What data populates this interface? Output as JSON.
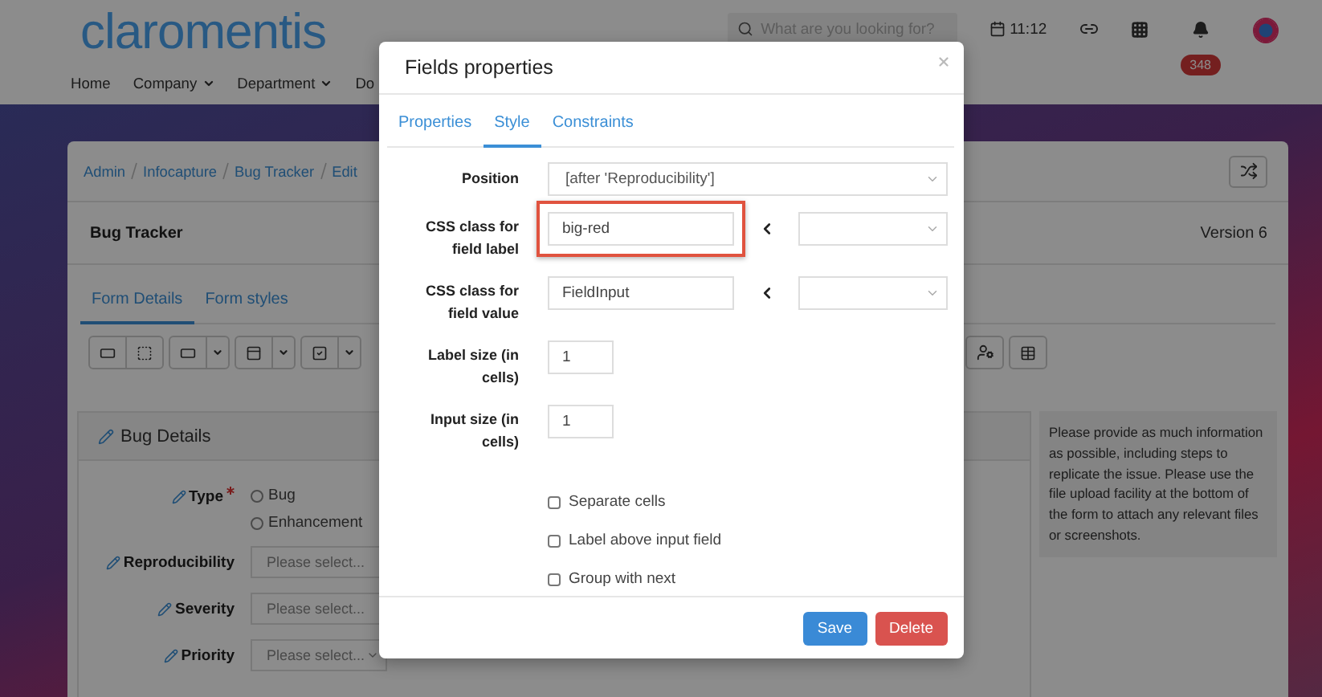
{
  "header": {
    "logo": "claromentis",
    "nav": [
      {
        "label": "Home",
        "dropdown": false
      },
      {
        "label": "Company",
        "dropdown": true
      },
      {
        "label": "Department",
        "dropdown": true
      },
      {
        "label": "Do",
        "dropdown": false
      }
    ],
    "search": {
      "placeholder": "What are you looking for?"
    },
    "time": "11:12",
    "notification_count": "348"
  },
  "breadcrumb": [
    "Admin",
    "Infocapture",
    "Bug Tracker",
    "Edit"
  ],
  "page": {
    "title": "Bug Tracker",
    "version": "Version 6"
  },
  "tabs": [
    {
      "label": "Form Details",
      "selected": true
    },
    {
      "label": "Form styles",
      "selected": false
    }
  ],
  "panel": {
    "title": "Bug Details",
    "fields": [
      {
        "kind": "radio",
        "label": "Type",
        "required": true,
        "options": [
          {
            "label": "Bug",
            "selected": false
          },
          {
            "label": "Enhancement",
            "selected": false
          }
        ]
      },
      {
        "kind": "select",
        "label": "Reproducibility",
        "required": false,
        "placeholder": "Please select..."
      },
      {
        "kind": "select",
        "label": "Severity",
        "required": false,
        "placeholder": "Please select..."
      },
      {
        "kind": "select",
        "label": "Priority",
        "required": false,
        "placeholder": "Please select..."
      }
    ]
  },
  "help_text": "Please provide as much information as possible, including steps to replicate the issue. Please use the file upload facility at the bottom of the form to attach any relevant files or screenshots.",
  "modal": {
    "title": "Fields properties",
    "tabs": [
      {
        "label": "Properties",
        "selected": false
      },
      {
        "label": "Style",
        "selected": true
      },
      {
        "label": "Constraints",
        "selected": false
      }
    ],
    "fields": [
      {
        "kind": "select",
        "label": "Position",
        "value": "[after 'Reproducibility']",
        "highlighted": false
      },
      {
        "kind": "class",
        "label": "CSS class for field label",
        "value": "big-red",
        "highlighted": true
      },
      {
        "kind": "class",
        "label": "CSS class for field value",
        "value": "FieldInput",
        "highlighted": false
      },
      {
        "kind": "number",
        "label": "Label size (in cells)",
        "value": "1",
        "highlighted": false
      },
      {
        "kind": "number",
        "label": "Input size (in cells)",
        "value": "1",
        "highlighted": false
      }
    ],
    "checkboxes": [
      {
        "label": "Separate cells",
        "checked": false
      },
      {
        "label": "Label above input field",
        "checked": false
      },
      {
        "label": "Group with next",
        "checked": false
      }
    ],
    "buttons": [
      {
        "label": "Save",
        "kind": "primary"
      },
      {
        "label": "Delete",
        "kind": "danger"
      }
    ]
  }
}
